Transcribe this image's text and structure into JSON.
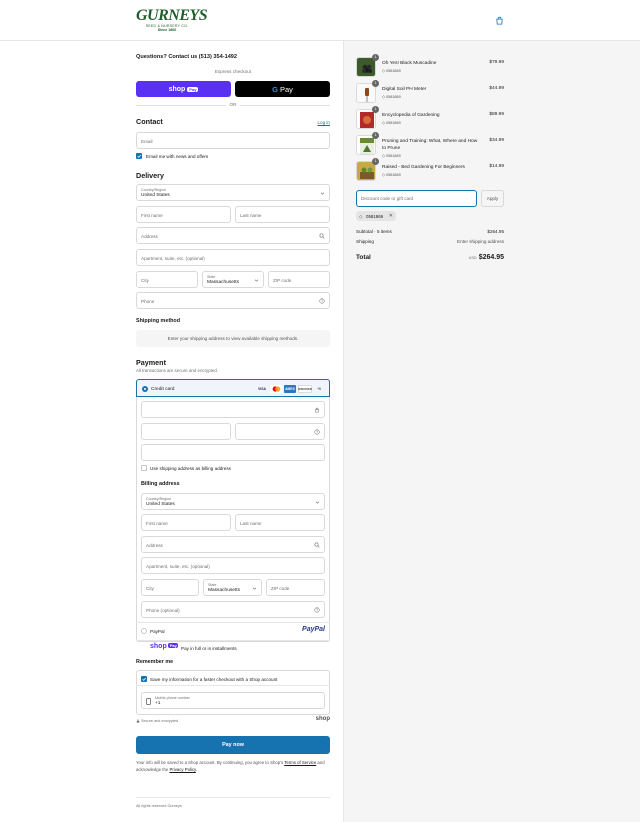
{
  "header": {
    "logo_main": "GURNEYS",
    "logo_sub": "SEED & NURSERY CO.",
    "logo_since": "Since 1866",
    "cart_icon": "shopping-bag-icon"
  },
  "checkout": {
    "questions": "Questions? Contact us (513) 354-1492",
    "express_label": "Express checkout",
    "shop_pay": {
      "brand": "shop",
      "pill": "Pay"
    },
    "gpay": {
      "g": "G",
      "label": "Pay"
    },
    "or": "OR"
  },
  "contact": {
    "title": "Contact",
    "login": "Log in",
    "email_placeholder": "Email",
    "news_label": "Email me with news and offers",
    "news_checked": true
  },
  "delivery": {
    "title": "Delivery",
    "country_label": "Country/Region",
    "country_value": "United States",
    "first_name": "First name",
    "last_name": "Last name",
    "address": "Address",
    "apartment": "Apartment, suite, etc. (optional)",
    "city": "City",
    "state_label": "State",
    "state_value": "Massachusetts",
    "zip": "ZIP code",
    "phone": "Phone"
  },
  "shipping_method": {
    "title": "Shipping method",
    "message": "Enter your shipping address to view available shipping methods."
  },
  "payment": {
    "title": "Payment",
    "subtitle": "All transactions are secure and encrypted.",
    "credit_card_label": "Credit card",
    "card_logos": [
      "VISA",
      "MC",
      "AMEX",
      "DISCOVER",
      "+5"
    ],
    "use_shipping_label": "Use shipping address as billing address",
    "billing_title": "Billing address",
    "billing": {
      "country_label": "Country/Region",
      "country_value": "United States",
      "first_name": "First name",
      "last_name": "Last name",
      "address": "Address",
      "apartment": "Apartment, suite, etc. (optional)",
      "city": "City",
      "state_label": "State",
      "state_value": "Massachusetts",
      "zip": "ZIP code",
      "phone": "Phone (optional)"
    },
    "paypal_label": "PayPal",
    "paypal_logo": "PayPal",
    "shoppay_brand": "shop",
    "shoppay_pill": "Pay",
    "shoppay_label": "Pay in full or in installments"
  },
  "remember": {
    "title": "Remember me",
    "save_label": "Save my information for a faster checkout with a Shop account",
    "save_checked": true,
    "mobile_label": "Mobile phone number",
    "mobile_value": "+1",
    "secure_label": "Secure and encrypted",
    "shop_logo": "shop"
  },
  "pay_now": "Pay now",
  "fine_print": {
    "part1": "Your info will be saved to a Shop account. By continuing, you agree to Shop's ",
    "tos": "Terms of Service",
    "part2": " and acknowledge the ",
    "privacy": "Privacy Policy",
    "part3": "."
  },
  "footer": "All rights reserved Gurneys",
  "order": {
    "items": [
      {
        "name": "Oh Yes! Black Muscadine",
        "price": "$79.99",
        "qty": "1",
        "tag": "0581869"
      },
      {
        "name": "Digital Soil PH Meter",
        "price": "$44.99",
        "qty": "1",
        "tag": "0581869"
      },
      {
        "name": "Encyclopedia of Gardening",
        "price": "$89.99",
        "qty": "1",
        "tag": "0581869"
      },
      {
        "name": "Pruning and Training: What, Where and How to Prune",
        "price": "$34.99",
        "qty": "1",
        "tag": "0581869"
      },
      {
        "name": "Raised - Bed Gardening For Beginners",
        "price": "$14.99",
        "qty": "1",
        "tag": "0581869"
      }
    ],
    "discount_placeholder": "Discount code or gift card",
    "apply": "Apply",
    "chip_code": "0581869",
    "subtotal_label": "Subtotal · 5 items",
    "subtotal_value": "$264.95",
    "shipping_label": "Shipping",
    "shipping_value": "Enter shipping address",
    "total_label": "Total",
    "currency": "USD",
    "total_value": "$264.95"
  },
  "colors": {
    "accent": "#1773b0",
    "shop_purple": "#5a31f4",
    "brand_green": "#1e5e2a"
  }
}
